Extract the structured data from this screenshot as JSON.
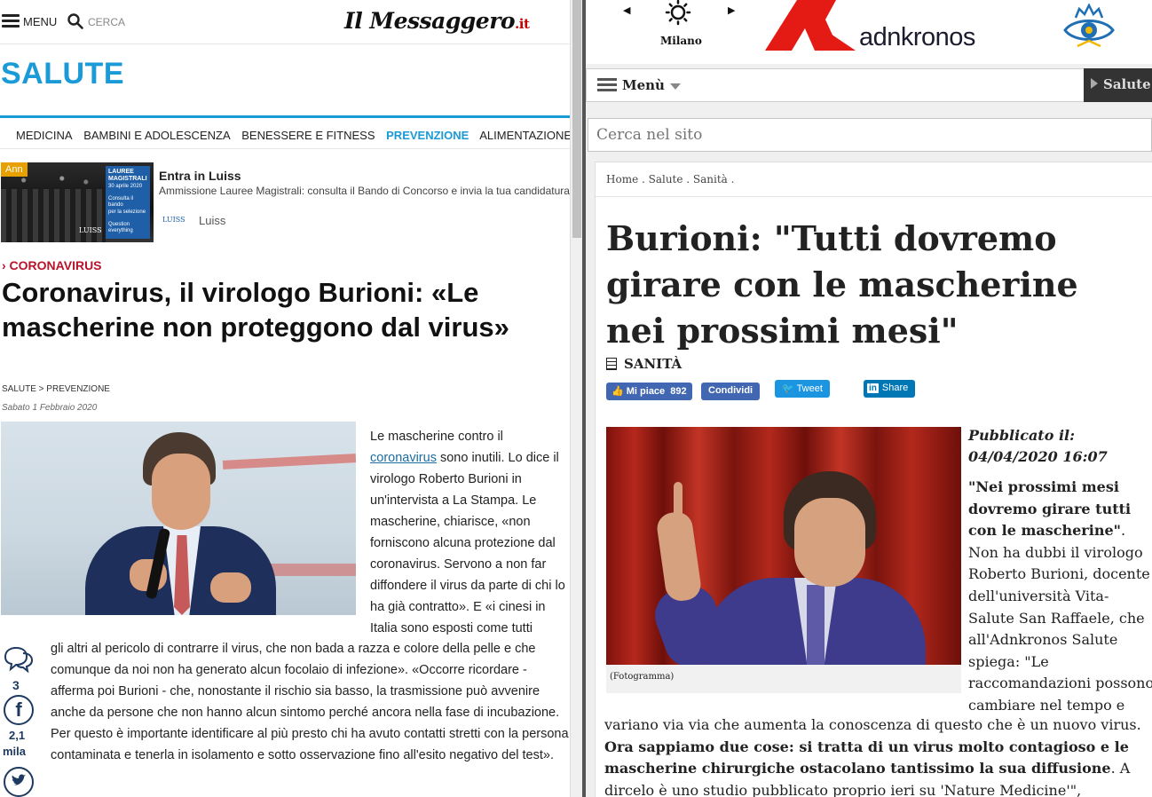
{
  "left": {
    "header": {
      "menu_label": "MENU",
      "search_label": "CERCA",
      "logo_text": "Il Messaggero",
      "logo_suffix": ".it"
    },
    "section_title": "SALUTE",
    "subnav": [
      "MEDICINA",
      "BAMBINI E ADOLESCENZA",
      "BENESSERE E FITNESS",
      "PREVENZIONE",
      "ALIMENTAZIONE"
    ],
    "subnav_active": "PREVENZIONE",
    "ad": {
      "tag": "Ann",
      "badge_title": "LAUREE MAGISTRALI",
      "badge_date": "30 aprile 2020",
      "badge_line1": "Consulta il bando",
      "badge_line2": "per la selezione",
      "badge_line3": "Question everything",
      "mark": "LUISS",
      "title": "Entra in Luiss",
      "description": "Ammissione Lauree Magistrali: consulta il Bando di Concorso e invia la tua candidatura",
      "brand_logo": "LUISS",
      "brand": "Luiss"
    },
    "article": {
      "kicker": "› CORONAVIRUS",
      "headline": "Coronavirus, il virologo Burioni: «Le mascherine non proteggono dal virus»",
      "breadcrumb": "SALUTE > PREVENZIONE",
      "date": "Sabato 1 Febbraio 2020",
      "body_part1_pre": "Le mascherine contro il ",
      "body_link": "coronavirus",
      "body_part1_post": " sono inutili. Lo dice il virologo Roberto Burioni in un'intervista a La Stampa. Le mascherine, chiarisce, «non forniscono alcuna protezione dal coronavirus. Servono a non far diffondere il virus da parte di chi lo ha già contratto». E «i cinesi in Italia sono esposti come tutti",
      "body_part2": "gli altri al pericolo di contrarre il virus, che non bada a razza e colore della pelle e che comunque da noi non ha generato alcun focolaio di infezione». «Occorre ricordare - afferma poi Burioni - che, nonostante il rischio sia basso, la trasmissione può avvenire anche da persone che non hanno alcun sintomo perché ancora nella fase di incubazione. Per questo è importante identificare al più presto chi ha avuto contatti stretti con la persona contaminata e tenerla in isolamento e sotto osservazione fino all'esito negativo del test»."
    },
    "share": {
      "comments_count": "3",
      "facebook_count_line1": "2,1",
      "facebook_count_line2": "mila"
    },
    "icons": {
      "menu": "hamburger-icon",
      "search": "search-icon",
      "comment": "comment-icon",
      "facebook": "facebook-icon",
      "twitter": "twitter-icon"
    },
    "colors": {
      "accent": "#1a9ad6",
      "kicker": "#b8132b"
    }
  },
  "right": {
    "header": {
      "city": "Milano",
      "weather_icon": "sun-icon",
      "logo_text": "adnkronos"
    },
    "menu_label": "Menù",
    "section_button": "Salute",
    "search_placeholder": "Cerca nel sito",
    "breadcrumb": "Home . Salute . Sanità .",
    "headline": "Burioni: \"Tutti dovremo girare con le mascherine nei prossimi mesi\"",
    "category": "SANITÀ",
    "social": {
      "like_label": "Mi piace",
      "like_count": "892",
      "share_label": "Condividi",
      "tweet_label": "Tweet",
      "linkedin_label": "Share"
    },
    "photo_caption": "(Fotogramma)",
    "published_label": "Pubblicato il:",
    "published_date": "04/04/2020 16:07",
    "lead_quote": "\"Nei prossimi mesi dovremo girare tutti con le mascherine\"",
    "lead_rest": ". Non ha dubbi il virologo Roberto Burioni, docente dell'università Vita-Salute San Raffaele, che all'Adnkronos Salute spiega: \"Le raccomandazioni possono cambiare nel tempo e",
    "body_part1": "variano via via che aumenta la conoscenza di questo che è un nuovo virus. ",
    "body_bold": "Ora sappiamo due cose: si tratta di un virus molto contagioso e le mascherine chirurgiche ostacolano tantissimo la sua diffusione",
    "body_part2": ". A dircelo è uno studio pubblicato proprio ieri su 'Nature Medicine'\", sottolinea il",
    "colors": {
      "brand_red": "#e31b14",
      "dark_bar": "#333333"
    }
  }
}
